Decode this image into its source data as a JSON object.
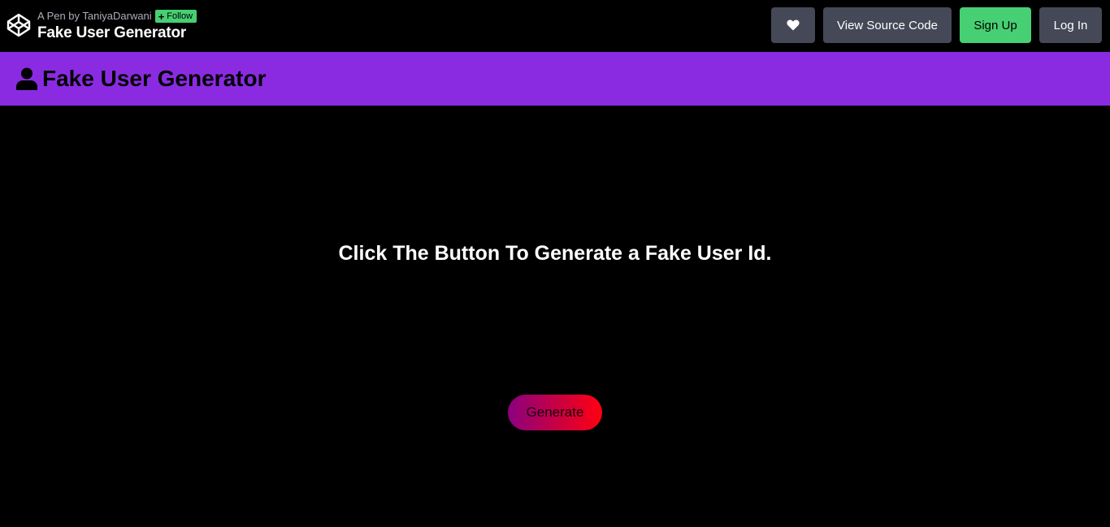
{
  "codepen": {
    "pen_by": "A Pen by TaniyaDarwani",
    "follow_label": "Follow",
    "pen_title": "Fake User Generator",
    "buttons": {
      "heart_icon": "heart-icon",
      "view_source": "View Source Code",
      "sign_up": "Sign Up",
      "log_in": "Log In"
    },
    "colors": {
      "bar_bg": "#000000",
      "button_bg": "#444857",
      "accent_green": "#47cf73"
    }
  },
  "app": {
    "header_icon": "user-icon",
    "title": "Fake User Generator",
    "header_color": "#8a2be2",
    "prompt": "Click The Button To Generate a Fake User Id.",
    "generate_label": "Generate",
    "generate_gradient": [
      "#8b0080",
      "#ff0010"
    ]
  }
}
